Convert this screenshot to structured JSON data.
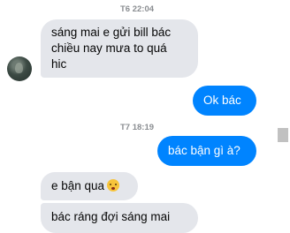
{
  "messages": [
    {
      "type": "time",
      "text": "T6 22:04"
    },
    {
      "type": "in",
      "lines": [
        "sáng mai e gửi bill bác",
        "chiều nay mưa to quá",
        "hic"
      ]
    },
    {
      "type": "out",
      "text": "Ok bác"
    },
    {
      "type": "time",
      "text": "T7 18:19"
    },
    {
      "type": "out",
      "text": "bác bận gì à?"
    },
    {
      "type": "in",
      "text": "e bận qua",
      "emoji": "confounded-face-icon"
    },
    {
      "type": "in",
      "text": "bác ráng đợi sáng mai"
    }
  ],
  "colors": {
    "incoming_bubble": "#e4e6eb",
    "outgoing_bubble": "#0084ff",
    "timestamp": "#8a8d91"
  }
}
